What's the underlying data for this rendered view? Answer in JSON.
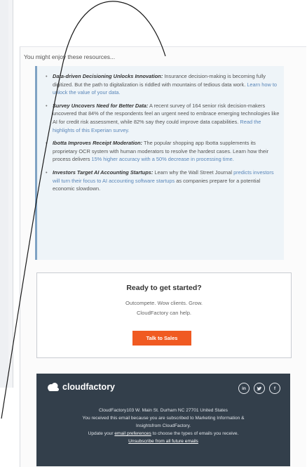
{
  "intro": "You might enjoy these resources...",
  "resources": [
    {
      "title": "Data-driven Decisioning Unlocks Innovation:",
      "body": " Insurance decision-making is becoming fully digitized. But the path to digitalization is riddled with mountains of tedious data work. ",
      "link": "Learn how to unlock the value of your data.",
      "tail": ""
    },
    {
      "title": "Survey Uncovers Need for Better Data:",
      "body": " A recent survey of 164 senior risk decision-makers uncovered that 84% of the respondents feel an urgent need to embrace emerging technologies like AI for credit risk assessment, while 82% say they could improve data capabilities. ",
      "link": "Read the highlights of this Experian survey.",
      "tail": ""
    },
    {
      "title": "Ibotta Improves Receipt Moderation:",
      "body": " The popular shopping app Ibotta supplements its proprietary OCR system with human moderators to resolve the hardest cases. Learn how their process delivers ",
      "link": "15% higher accuracy with a 50% decrease in processing time.",
      "tail": ""
    },
    {
      "title": "Investors Target AI Accounting Startups:",
      "body": " Learn why the Wall Street Journal ",
      "link": "predicts investors will turn their focus to AI accounting software startups",
      "tail": " as companies prepare for a potential economic slowdown."
    }
  ],
  "cta": {
    "title": "Ready to get started?",
    "line1": "Outcompete. Wow clients. Grow.",
    "line2": "CloudFactory can help.",
    "button": "Talk to Sales",
    "button_color": "#f05a22"
  },
  "footer": {
    "logo": "cloudfactory",
    "social": [
      "in",
      "♥",
      "f"
    ],
    "address": "CloudFactory103 W. Main St. Durham NC 27701 United States",
    "notice1": "You received this email because you are subscribed to Marketing Information &",
    "notice2": "Insightsfrom CloudFactory.",
    "update_pre": "Update your ",
    "update_link": "email preferences",
    "update_post": " to choose the types of emails you receive.",
    "unsubscribe": "Unsubscribe from all future emails",
    "bg_color": "#333f4b"
  }
}
